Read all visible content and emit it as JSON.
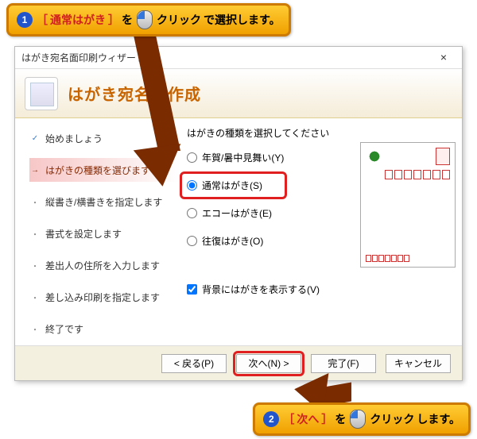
{
  "callouts": {
    "c1_num": "1",
    "c1_br_open": "［",
    "c1_target": "通常はがき",
    "c1_br_close": "］",
    "c1_mid": "を",
    "c1_action": "クリック",
    "c1_tail": "で選択します。",
    "c2_num": "2",
    "c2_br_open": "［",
    "c2_target": "次へ",
    "c2_br_close": "］",
    "c2_mid": "を",
    "c2_action": "クリック",
    "c2_tail": "します。"
  },
  "window": {
    "title": "はがき宛名面印刷ウィザード",
    "close": "×",
    "heading": "はがき宛名面作成"
  },
  "steps": {
    "s1": "始めましょう",
    "s2": "はがきの種類を選びます",
    "s3": "縦書き/横書きを指定します",
    "s4": "書式を設定します",
    "s5": "差出人の住所を入力します",
    "s6": "差し込み印刷を指定します",
    "s7": "終了です",
    "mark_done": "✓",
    "mark_current": "→",
    "mark_pending": "・"
  },
  "content": {
    "prompt": "はがきの種類を選択してください",
    "r1": "年賀/暑中見舞い(Y)",
    "r2": "通常はがき(S)",
    "r3": "エコーはがき(E)",
    "r4": "往復はがき(O)",
    "check": "背景にはがきを表示する(V)"
  },
  "buttons": {
    "back": "< 戻る(P)",
    "next": "次へ(N) >",
    "finish": "完了(F)",
    "cancel": "キャンセル"
  }
}
